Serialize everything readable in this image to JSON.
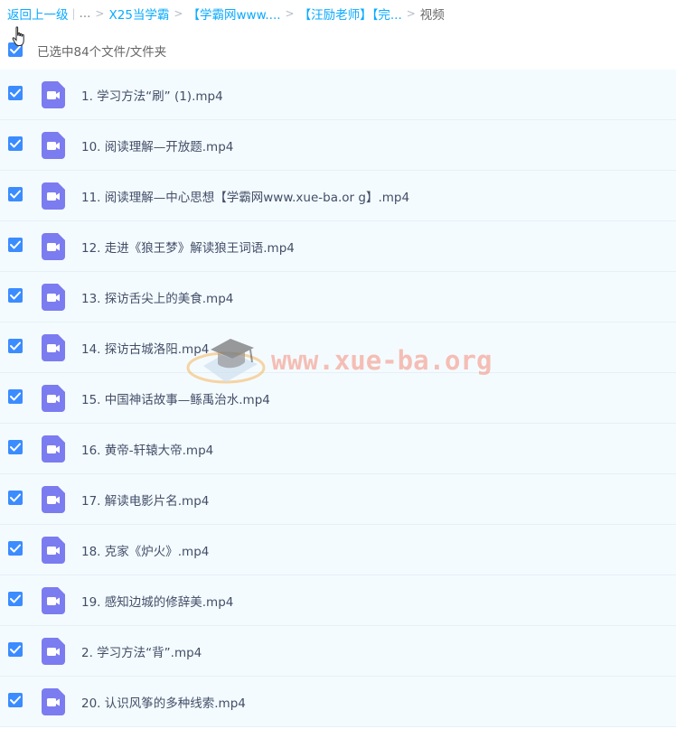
{
  "breadcrumb": {
    "back": "返回上一级",
    "ellipsis": "...",
    "items": [
      "X25当学霸",
      "【学霸网www....",
      "【汪励老师】【完...",
      "视频"
    ]
  },
  "selection": {
    "label": "已选中84个文件/文件夹",
    "checked": true
  },
  "files": [
    {
      "name": "1. 学习方法“刷” (1).mp4"
    },
    {
      "name": "10. 阅读理解—开放题.mp4"
    },
    {
      "name": "11. 阅读理解—中心思想【学霸网www.xue-ba.or g】.mp4"
    },
    {
      "name": "12. 走进《狼王梦》解读狼王词语.mp4"
    },
    {
      "name": "13. 探访舌尖上的美食.mp4"
    },
    {
      "name": "14. 探访古城洛阳.mp4"
    },
    {
      "name": "15. 中国神话故事—鲧禹治水.mp4"
    },
    {
      "name": "16. 黄帝-轩辕大帝.mp4"
    },
    {
      "name": "17. 解读电影片名.mp4"
    },
    {
      "name": "18. 克家《炉火》.mp4"
    },
    {
      "name": "19. 感知边城的修辞美.mp4"
    },
    {
      "name": "2. 学习方法“背”.mp4"
    },
    {
      "name": "20. 认识风筝的多种线索.mp4"
    }
  ],
  "watermark": {
    "text": "www.xue-ba.org"
  },
  "colors": {
    "link": "#09aaff",
    "checkbox": "#3b8cff",
    "video_icon": "#7b7cf0",
    "row_bg": "#f4fbff"
  }
}
